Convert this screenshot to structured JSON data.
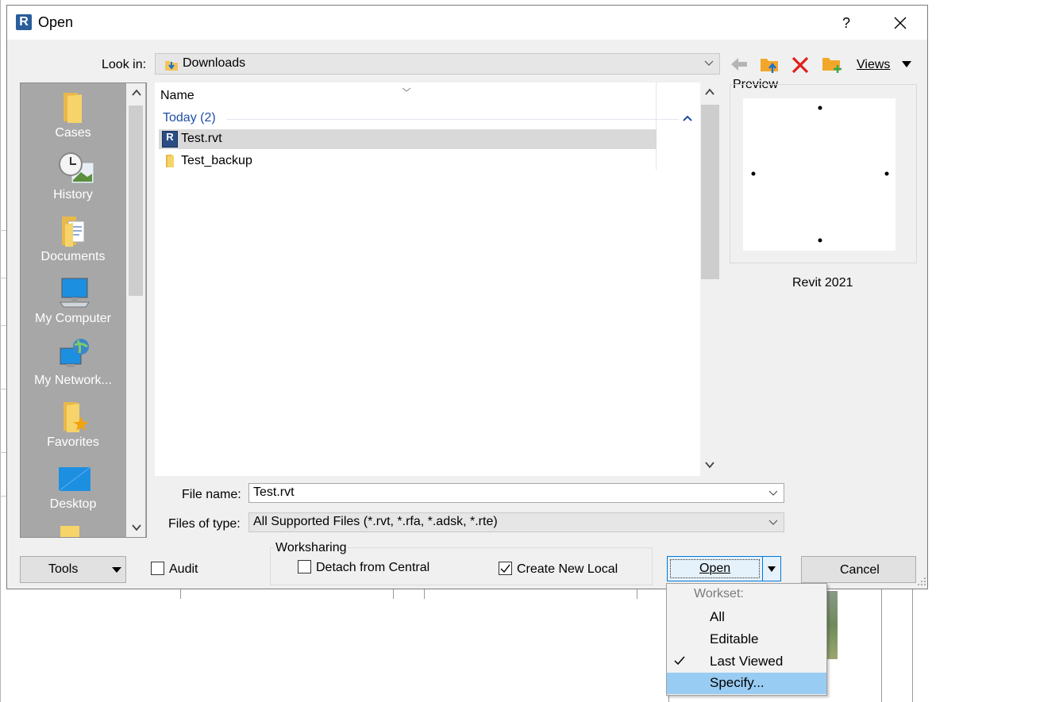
{
  "window": {
    "title": "Open",
    "help": "?",
    "app_icon": "R"
  },
  "look_in": {
    "label": "Look in:",
    "value": "Downloads"
  },
  "toolbar": {
    "views_label": "Views",
    "preview_label": "Preview"
  },
  "places": [
    {
      "label": "Cases",
      "icon": "folder-icon"
    },
    {
      "label": "History",
      "icon": "history-clock-icon"
    },
    {
      "label": "Documents",
      "icon": "documents-folder-icon"
    },
    {
      "label": "My Computer",
      "icon": "computer-icon"
    },
    {
      "label": "My Network...",
      "icon": "network-globe-icon"
    },
    {
      "label": "Favorites",
      "icon": "favorites-star-folder-icon"
    },
    {
      "label": "Desktop",
      "icon": "desktop-icon"
    }
  ],
  "file_list": {
    "column_name": "Name",
    "group_label": "Today (2)",
    "items": [
      {
        "name": "Test.rvt",
        "type": "rvt",
        "selected": true
      },
      {
        "name": "Test_backup",
        "type": "folder",
        "selected": false
      }
    ]
  },
  "preview": {
    "version": "Revit 2021"
  },
  "file_name": {
    "label": "File name:",
    "value": "Test.rvt"
  },
  "files_of_type": {
    "label": "Files of type:",
    "value": "All Supported Files  (*.rvt, *.rfa, *.adsk, *.rte)"
  },
  "bottom": {
    "tools_label": "Tools",
    "audit_label": "Audit",
    "audit_checked": false,
    "worksharing_label": "Worksharing",
    "detach_label": "Detach from Central",
    "detach_checked": false,
    "create_local_label": "Create New Local",
    "create_local_checked": true,
    "open_label": "Open",
    "cancel_label": "Cancel"
  },
  "workset_menu": {
    "header": "Workset:",
    "items": [
      {
        "label": "All",
        "checked": false,
        "highlighted": false
      },
      {
        "label": "Editable",
        "checked": false,
        "highlighted": false
      },
      {
        "label": "Last Viewed",
        "checked": true,
        "highlighted": false
      },
      {
        "label": "Specify...",
        "checked": false,
        "highlighted": true
      }
    ]
  },
  "colors": {
    "accent": "#0078d7",
    "group_text": "#1f4ea8",
    "menu_highlight": "#99ccf3",
    "sidebar": "#a7a7a7"
  }
}
